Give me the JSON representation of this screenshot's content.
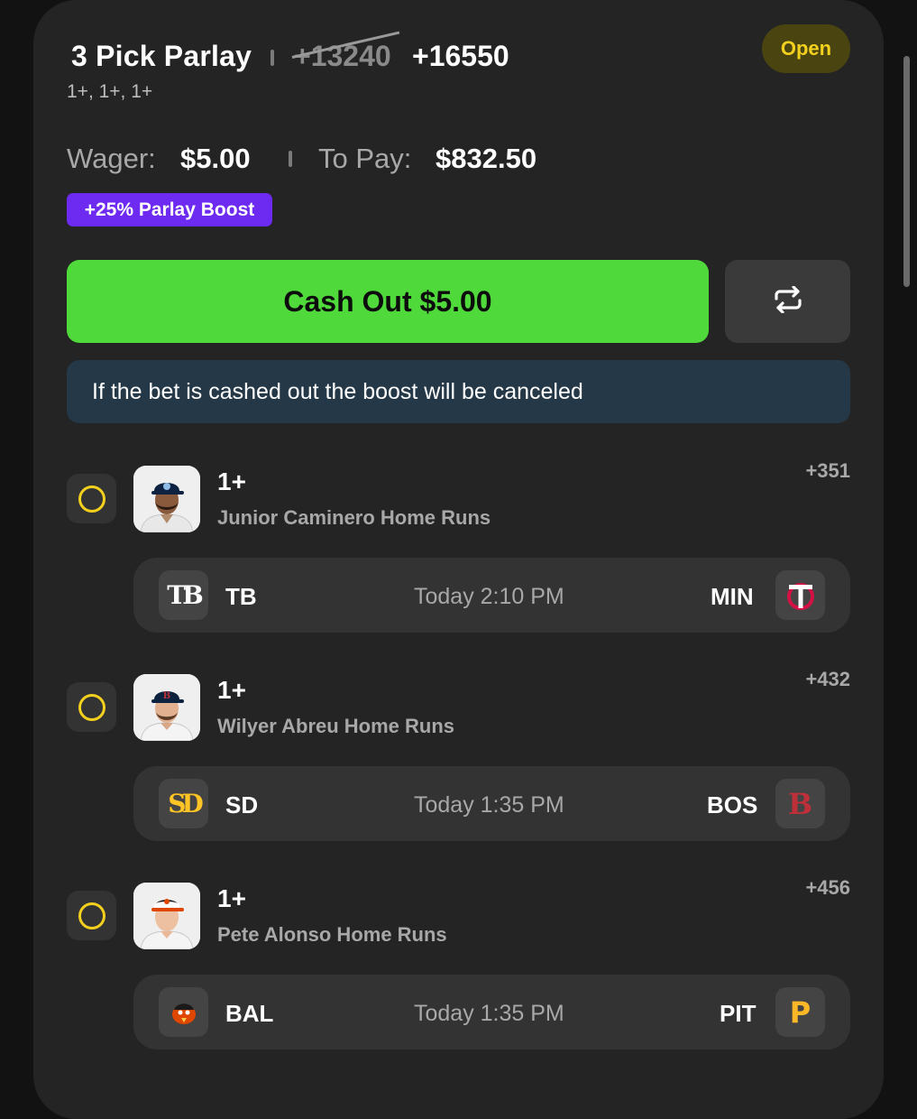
{
  "bet": {
    "title": "3 Pick Parlay",
    "original_odds": "+13240",
    "boosted_odds": "+16550",
    "legs_summary": "1+, 1+, 1+",
    "status": "Open",
    "wager_label": "Wager:",
    "wager_value": "$5.00",
    "topay_label": "To Pay:",
    "topay_value": "$832.50",
    "boost_label": "+25% Parlay Boost",
    "cashout_label": "Cash Out $5.00",
    "notice": "If the bet is cashed out the boost will be canceled"
  },
  "legs": [
    {
      "line": "1+",
      "market": "Junior Caminero Home Runs",
      "odds": "+351",
      "away": "TB",
      "home": "MIN",
      "time": "Today 2:10 PM",
      "away_logo_icon": "rays-logo-icon",
      "home_logo_icon": "twins-logo-icon"
    },
    {
      "line": "1+",
      "market": "Wilyer Abreu Home Runs",
      "odds": "+432",
      "away": "SD",
      "home": "BOS",
      "time": "Today 1:35 PM",
      "away_logo_icon": "padres-logo-icon",
      "home_logo_icon": "red-sox-logo-icon"
    },
    {
      "line": "1+",
      "market": "Pete Alonso Home Runs",
      "odds": "+456",
      "away": "BAL",
      "home": "PIT",
      "time": "Today 1:35 PM",
      "away_logo_icon": "orioles-logo-icon",
      "home_logo_icon": "pirates-logo-icon"
    }
  ],
  "colors": {
    "accent_green": "#4fd93a",
    "status_yellow": "#f4d01e",
    "boost_purple": "#6d2af0",
    "notice_blue": "#243847"
  }
}
